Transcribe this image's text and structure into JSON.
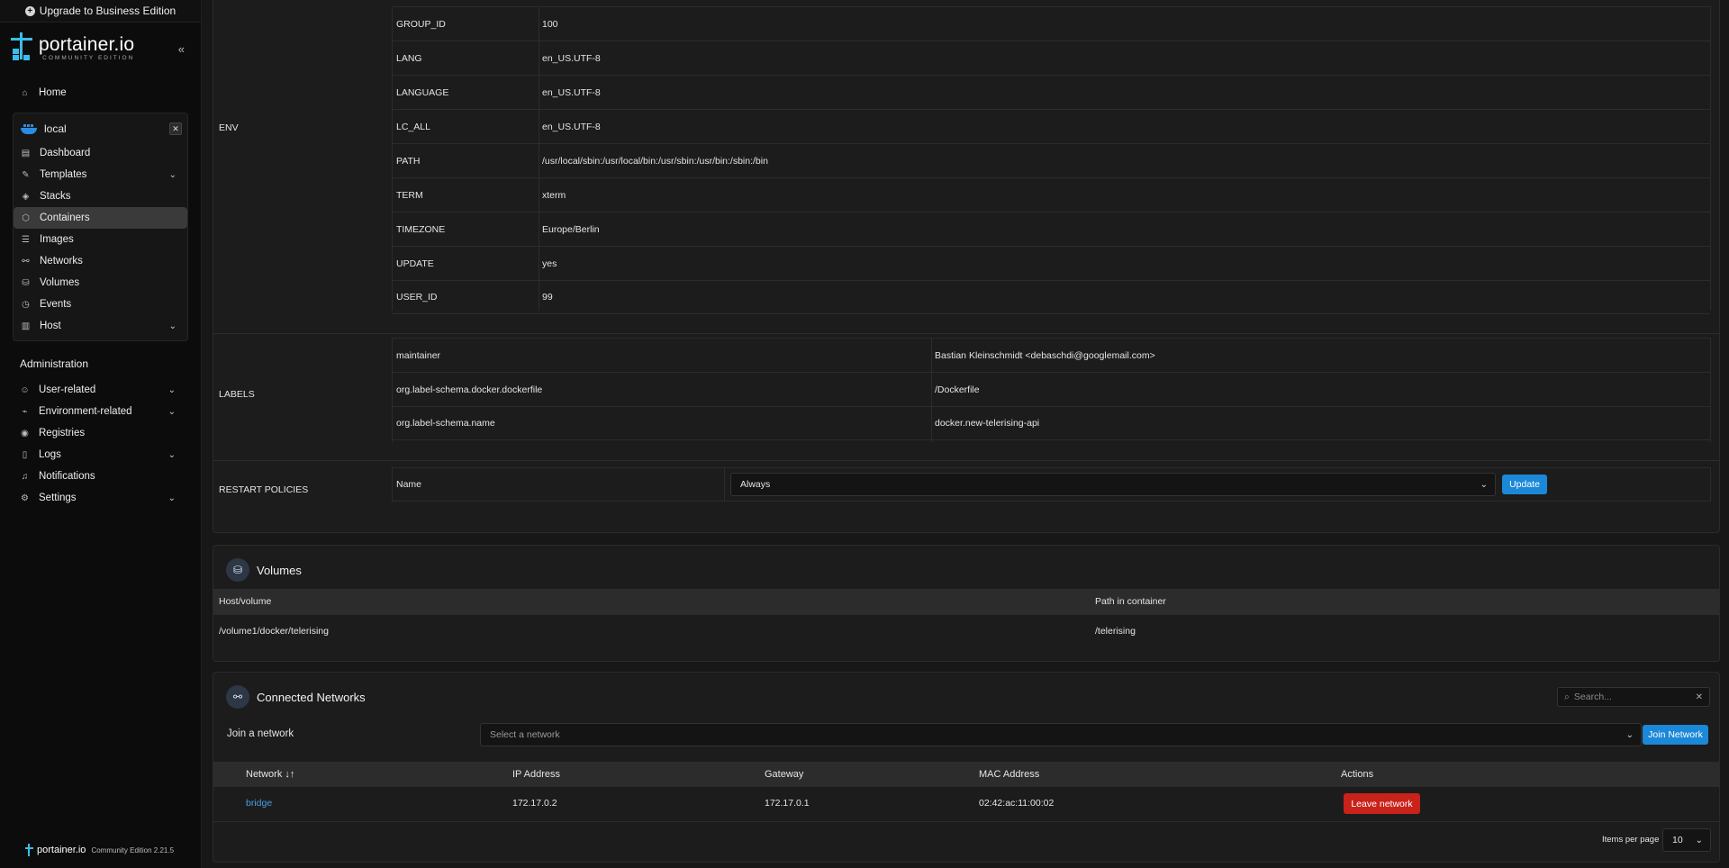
{
  "sidebar": {
    "upgrade_label": "Upgrade to Business Edition",
    "brand": "portainer.io",
    "edition": "COMMUNITY EDITION",
    "home": "Home",
    "env_name": "local",
    "env_items": [
      {
        "label": "Dashboard",
        "icon": "dashboard-icon"
      },
      {
        "label": "Templates",
        "icon": "edit-icon"
      },
      {
        "label": "Stacks",
        "icon": "layers-icon"
      },
      {
        "label": "Containers",
        "icon": "box-icon"
      },
      {
        "label": "Images",
        "icon": "list-icon"
      },
      {
        "label": "Networks",
        "icon": "network-icon"
      },
      {
        "label": "Volumes",
        "icon": "database-icon"
      },
      {
        "label": "Events",
        "icon": "clock-icon"
      },
      {
        "label": "Host",
        "icon": "server-icon"
      }
    ],
    "admin_title": "Administration",
    "admin_items": [
      {
        "label": "User-related"
      },
      {
        "label": "Environment-related"
      },
      {
        "label": "Registries"
      },
      {
        "label": "Logs"
      },
      {
        "label": "Notifications"
      },
      {
        "label": "Settings"
      }
    ],
    "footer_brand": "portainer.io",
    "footer_version": "Community Edition 2.21.5"
  },
  "details": {
    "env_label": "ENV",
    "env": [
      {
        "k": "GROUP_ID",
        "v": "100"
      },
      {
        "k": "LANG",
        "v": "en_US.UTF-8"
      },
      {
        "k": "LANGUAGE",
        "v": "en_US.UTF-8"
      },
      {
        "k": "LC_ALL",
        "v": "en_US.UTF-8"
      },
      {
        "k": "PATH",
        "v": "/usr/local/sbin:/usr/local/bin:/usr/sbin:/usr/bin:/sbin:/bin"
      },
      {
        "k": "TERM",
        "v": "xterm"
      },
      {
        "k": "TIMEZONE",
        "v": "Europe/Berlin"
      },
      {
        "k": "UPDATE",
        "v": "yes"
      },
      {
        "k": "USER_ID",
        "v": "99"
      }
    ],
    "labels_label": "LABELS",
    "labels": [
      {
        "k": "maintainer",
        "v": "Bastian Kleinschmidt <debaschdi@googlemail.com>"
      },
      {
        "k": "org.label-schema.docker.dockerfile",
        "v": "/Dockerfile"
      },
      {
        "k": "org.label-schema.name",
        "v": "docker.new-telerising-api"
      }
    ],
    "restart_label": "RESTART POLICIES",
    "restart_name": "Name",
    "restart_value": "Always",
    "update_button": "Update"
  },
  "volumes": {
    "title": "Volumes",
    "col_host": "Host/volume",
    "col_path": "Path in container",
    "rows": [
      {
        "host": "/volume1/docker/telerising",
        "path": "/telerising"
      }
    ]
  },
  "networks": {
    "title": "Connected Networks",
    "search_placeholder": "Search...",
    "join_label": "Join a network",
    "join_placeholder": "Select a network",
    "join_button": "Join Network",
    "cols": {
      "network": "Network",
      "ip": "IP Address",
      "gateway": "Gateway",
      "mac": "MAC Address",
      "actions": "Actions"
    },
    "rows": [
      {
        "network": "bridge",
        "ip": "172.17.0.2",
        "gateway": "172.17.0.1",
        "mac": "02:42:ac:11:00:02",
        "action": "Leave network"
      }
    ],
    "items_per_page_label": "Items per page",
    "items_per_page": "10"
  },
  "colors": {
    "accent": "#1b88d8",
    "danger": "#c9221b",
    "link": "#4a9fe5"
  }
}
